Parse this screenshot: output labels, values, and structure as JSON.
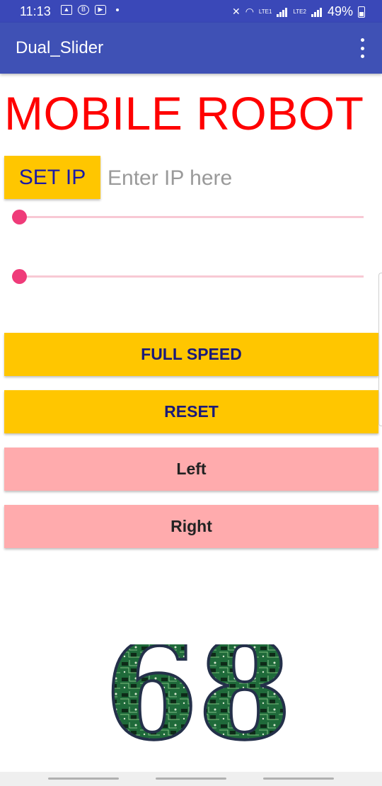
{
  "status_bar": {
    "time": "11:13",
    "battery": "49%",
    "sim1": "LTE1",
    "sim2": "LTE2"
  },
  "app_bar": {
    "title": "Dual_Slider"
  },
  "headline": "MOBILE ROBOT",
  "ip": {
    "button_label": "SET IP",
    "placeholder": "Enter IP here",
    "value": ""
  },
  "sliders": [
    {
      "value": 0
    },
    {
      "value": 0
    }
  ],
  "buttons": {
    "full_speed": "FULL SPEED",
    "reset": "RESET",
    "left": "Left",
    "right": "Right"
  },
  "logo": {
    "text": "68"
  },
  "colors": {
    "status_bar": "#3a48b8",
    "app_bar": "#3f51b5",
    "headline": "#ff0000",
    "accent_yellow": "#ffc600",
    "accent_pink": "#ffabad",
    "slider_thumb": "#ef3b79"
  }
}
